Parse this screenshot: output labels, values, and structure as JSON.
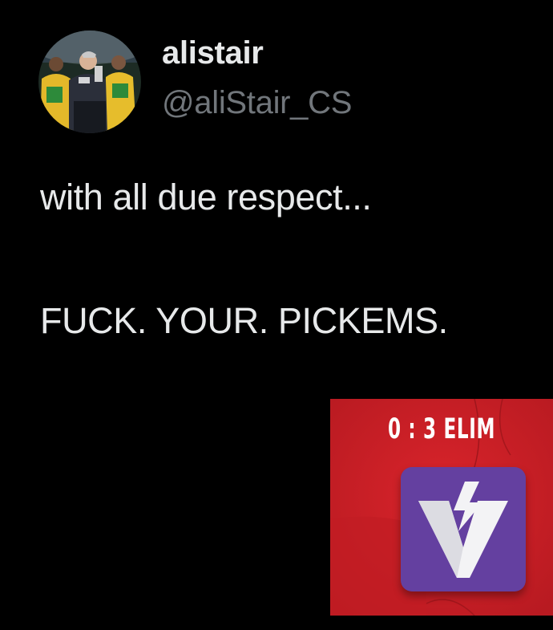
{
  "author": {
    "display_name": "alistair",
    "handle": "@aliStair_CS"
  },
  "tweet": {
    "line_1": "with all due respect...",
    "line_2": "FUCK. YOUR. PICKEMS."
  },
  "media": {
    "banner_text": "0 : 3 ELIM",
    "background_color": "#cf2027",
    "badge_color": "#6440a0",
    "badge_icon": "team-logo-icon"
  },
  "colors": {
    "background": "#000000",
    "primary_text": "#e7e9ea",
    "secondary_text": "#71767b"
  }
}
